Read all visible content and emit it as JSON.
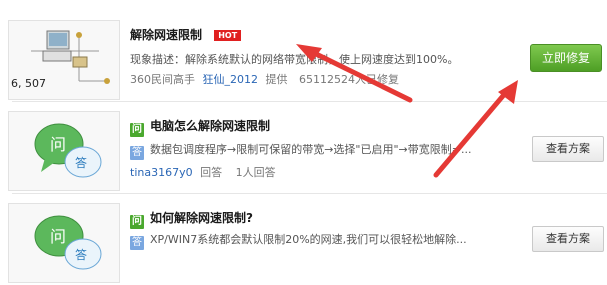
{
  "results": [
    {
      "title": "解除网速限制",
      "badge": "HOT",
      "description": "现象描述：解除系统默认的网络带宽限制，使上网速度达到100%。",
      "author": "360民间高手",
      "source_name": "狂仙_2012",
      "source_suffix": "提供",
      "count": "65112524人已修复",
      "thumb_text": "6, 507",
      "button": "立即修复"
    },
    {
      "title": "电脑怎么解除网速限制",
      "q_badge": "问",
      "a_badge": "答",
      "answer": "数据包调度程序→限制可保留的带宽→选择\"已启用\"→带宽限制=...",
      "user": "tina3167y0",
      "answers": "回答",
      "answerers": "1人回答",
      "thumb_q": "问",
      "thumb_a": "答",
      "button": "查看方案"
    },
    {
      "title": "如何解除网速限制?",
      "q_badge": "问",
      "a_badge": "答",
      "answer": "XP/WIN7系统都会默认限制20%的网速,我们可以很轻松地解除...",
      "thumb_q": "问",
      "thumb_a": "答",
      "button": "查看方案"
    }
  ],
  "colors": {
    "green_button": "#4e9f25",
    "hot_badge": "#e02020",
    "arrow": "#e53935",
    "link_blue": "#2a66b5"
  }
}
